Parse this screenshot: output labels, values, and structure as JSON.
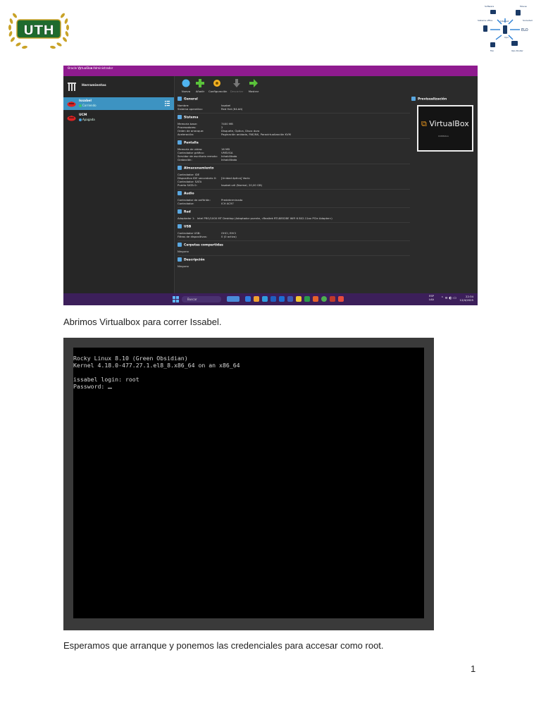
{
  "header": {
    "logo_text": "UTH",
    "diagram_labels": [
      "Software",
      "Mouse",
      "Sistema office",
      "Internet",
      "Sociedad",
      "ELO",
      "Pc",
      "Fax",
      "Usuario",
      "Cpu",
      "Red",
      "Ops Router"
    ]
  },
  "vbox": {
    "window_title": "Oracle VirtualBox Administrador",
    "menu": [
      "Archivo",
      "Máquina",
      "Ayuda"
    ],
    "tools_label": "Herramientas",
    "vms": [
      {
        "name": "Issabel",
        "state": "Corriendo",
        "selected": true,
        "state_color": "#3ec46d"
      },
      {
        "name": "UCM",
        "state": "Apagada",
        "selected": false,
        "state_color": "#4aa3df"
      }
    ],
    "toolbar": [
      {
        "label": "Nueva",
        "icon": "new-icon",
        "disabled": false
      },
      {
        "label": "Añadir",
        "icon": "add-icon",
        "disabled": false
      },
      {
        "label": "Configuración",
        "icon": "gear-icon",
        "disabled": false
      },
      {
        "label": "Descartar",
        "icon": "discard-icon",
        "disabled": true
      },
      {
        "label": "Mostrar",
        "icon": "show-icon",
        "disabled": false
      }
    ],
    "sections": [
      {
        "title": "General",
        "rows": [
          [
            "Nombre:",
            "Issabel"
          ],
          [
            "Sistema operativo:",
            "Red Hat (64-bit)"
          ]
        ]
      },
      {
        "title": "Sistema",
        "rows": [
          [
            "Memoria base:",
            "7400 MB"
          ],
          [
            "Procesadores:",
            "2"
          ],
          [
            "Orden de arranque:",
            "Disquete, Óptica, Disco duro"
          ],
          [
            "Aceleración:",
            "Paginación anidada, PAE/NX, Paravirtualización KVM"
          ]
        ]
      },
      {
        "title": "Pantalla",
        "rows": [
          [
            "Memoria de video:",
            "16 MB"
          ],
          [
            "Controlador gráfico:",
            "VMSVGA"
          ],
          [
            "Servidor de escritorio remoto:",
            "Inhabilitado"
          ],
          [
            "Grabación:",
            "Inhabilitado"
          ]
        ]
      },
      {
        "title": "Almacenamiento",
        "rows": [
          [
            "Controlador: IDE",
            ""
          ],
          [
            "  Dispositivo IDE secundario 0:",
            "[Unidad óptica] Vacío"
          ],
          [
            "Controlador: SATA",
            ""
          ],
          [
            "  Puerto SATA 0:",
            "Issabel.vdi (Normal, 20,00 GB)"
          ]
        ]
      },
      {
        "title": "Audio",
        "rows": [
          [
            "Controlador de anfitrión:",
            "Predeterminado"
          ],
          [
            "Controlador:",
            "ICH AC97"
          ]
        ]
      },
      {
        "title": "Red",
        "rows": [
          [
            "Adaptador 1:",
            "Intel PRO/1000 MT Desktop (Adaptador puente, «Realtek RTL8852BE WiFi 6 802.11ax PCIe Adapter»)"
          ]
        ]
      },
      {
        "title": "USB",
        "rows": [
          [
            "Controlador USB:",
            "OHCI, EHCI"
          ],
          [
            "Filtros de dispositivos:",
            "0 (0 activo)"
          ]
        ]
      },
      {
        "title": "Carpetas compartidas",
        "rows": [
          [
            "Ninguno",
            ""
          ]
        ]
      },
      {
        "title": "Descripción",
        "rows": [
          [
            "Ninguno",
            ""
          ]
        ]
      }
    ],
    "preview": {
      "title": "Previsualización",
      "brand": "VirtualBox",
      "subtitle": "CONSOLA"
    },
    "taskbar": {
      "search": "Buscar",
      "lang_top": "ESP",
      "lang_bottom": "LAA",
      "time": "22:34",
      "date": "12/4/2025"
    }
  },
  "caption1": "Abrimos Virtualbox para correr Issabel.",
  "terminal": {
    "lines": [
      "Rocky Linux 8.10 (Green Obsidian)",
      "Kernel 4.18.0-477.27.1.el8_8.x86_64 on an x86_64",
      "",
      "issabel login: root",
      "Password: "
    ]
  },
  "caption2": "Esperamos que arranque y ponemos las credenciales para accesar como root.",
  "page_number": "1"
}
